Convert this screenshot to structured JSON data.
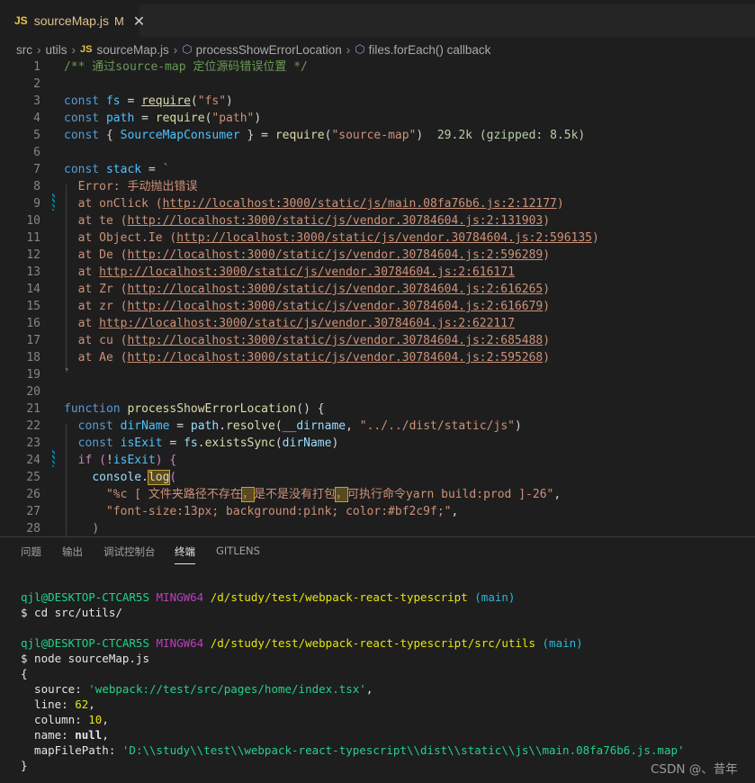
{
  "tab": {
    "icon": "JS",
    "filename": "sourceMap.js",
    "modified": "M",
    "close": "✕"
  },
  "breadcrumb": {
    "items": [
      "src",
      "utils",
      "sourceMap.js",
      "processShowErrorLocation",
      "files.forEach() callback"
    ],
    "js_icon": "JS"
  },
  "editor": {
    "line_numbers": [
      "1",
      "2",
      "3",
      "4",
      "5",
      "6",
      "7",
      "8",
      "9",
      "10",
      "11",
      "12",
      "13",
      "14",
      "15",
      "16",
      "17",
      "18",
      "19",
      "20",
      "21",
      "22",
      "23",
      "24",
      "25",
      "26",
      "27",
      "28"
    ],
    "l1": "/** 通过source-map 定位源码错误位置 */",
    "l3": {
      "kw": "const",
      "var": "fs",
      "eq": " = ",
      "fn": "require",
      "p1": "(",
      "str": "\"fs\"",
      "p2": ")"
    },
    "l4": {
      "kw": "const",
      "var": "path",
      "eq": " = ",
      "fn": "require",
      "p1": "(",
      "str": "\"path\"",
      "p2": ")"
    },
    "l5": {
      "kw": "const",
      "ob": " { ",
      "var": "SourceMapConsumer",
      "cb": " } = ",
      "fn": "require",
      "p1": "(",
      "str": "\"source-map\"",
      "p2": ")",
      "size": "29.2k (gzipped: 8.5k)"
    },
    "l7": {
      "kw": "const",
      "var": "stack",
      "eq": " = ",
      "str": "`"
    },
    "stack_lines": [
      {
        "pre": "  Error: 手动抛出错误",
        "url": ""
      },
      {
        "pre": "  at onClick (",
        "url": "http://localhost:3000/static/js/main.08fa76b6.js:2:12177",
        "post": ")"
      },
      {
        "pre": "  at te (",
        "url": "http://localhost:3000/static/js/vendor.30784604.js:2:131903",
        "post": ")"
      },
      {
        "pre": "  at Object.Ie (",
        "url": "http://localhost:3000/static/js/vendor.30784604.js:2:596135",
        "post": ")"
      },
      {
        "pre": "  at De (",
        "url": "http://localhost:3000/static/js/vendor.30784604.js:2:596289",
        "post": ")"
      },
      {
        "pre": "  at ",
        "url": "http://localhost:3000/static/js/vendor.30784604.js:2:616171",
        "post": ""
      },
      {
        "pre": "  at Zr (",
        "url": "http://localhost:3000/static/js/vendor.30784604.js:2:616265",
        "post": ")"
      },
      {
        "pre": "  at zr (",
        "url": "http://localhost:3000/static/js/vendor.30784604.js:2:616679",
        "post": ")"
      },
      {
        "pre": "  at ",
        "url": "http://localhost:3000/static/js/vendor.30784604.js:2:622117",
        "post": ""
      },
      {
        "pre": "  at cu (",
        "url": "http://localhost:3000/static/js/vendor.30784604.js:2:685488",
        "post": ")"
      },
      {
        "pre": "  at Ae (",
        "url": "http://localhost:3000/static/js/vendor.30784604.js:2:595268",
        "post": ")"
      }
    ],
    "l19": "`",
    "l21": {
      "kw": "function",
      "fn": "processShowErrorLocation",
      "rest": "() {"
    },
    "l22": {
      "kw": "const",
      "var": "dirName",
      "eq": " = ",
      "obj": "path",
      "dot": ".",
      "fn": "resolve",
      "p1": "(",
      "arg": "__dirname",
      "comma": ", ",
      "str": "\"../../dist/static/js\"",
      "p2": ")"
    },
    "l23": {
      "kw": "const",
      "var": "isExit",
      "eq": " = ",
      "obj": "fs",
      "dot": ".",
      "fn": "existsSync",
      "p1": "(",
      "arg": "dirName",
      "p2": ")"
    },
    "l24": {
      "kw": "if",
      "open": " (",
      "not": "!",
      "var": "isExit",
      "close": ") {"
    },
    "l25": {
      "obj": "console",
      "dot": ".",
      "fn": "log",
      "p1": "("
    },
    "l26": {
      "s1": "\"%c [ 文件夹路径不存在",
      "s2": "，",
      "s3": "是不是没有打包",
      "s4": "，",
      "s5": "可执行命令yarn build:prod ]-26\"",
      "comma": ","
    },
    "l27": {
      "str": "\"font-size:13px; background:pink; color:#bf2c9f;\"",
      "comma": ","
    },
    "l28": ")"
  },
  "panel": {
    "tabs": [
      "问题",
      "输出",
      "调试控制台",
      "终端",
      "GITLENS"
    ],
    "active": "终端"
  },
  "terminal": {
    "user": "qjl@DESKTOP-CTCAR5S",
    "shell": "MINGW64",
    "path1": "/d/study/test/webpack-react-typescript",
    "branch": "(main)",
    "cmd1": "$ cd src/utils/",
    "path2": "/d/study/test/webpack-react-typescript/src/utils",
    "cmd2": "$ node sourceMap.js",
    "brace_open": "{",
    "source_key": "  source: ",
    "source_val": "'webpack://test/src/pages/home/index.tsx'",
    "line_key": "  line: ",
    "line_val": "62",
    "column_key": "  column: ",
    "column_val": "10",
    "name_key": "  name: ",
    "name_val": "null",
    "map_key": "  mapFilePath: ",
    "map_val": "'D:\\\\study\\\\test\\\\webpack-react-typescript\\\\dist\\\\static\\\\js\\\\main.08fa76b6.js.map'",
    "brace_close": "}"
  },
  "watermark": "CSDN @、昔年"
}
